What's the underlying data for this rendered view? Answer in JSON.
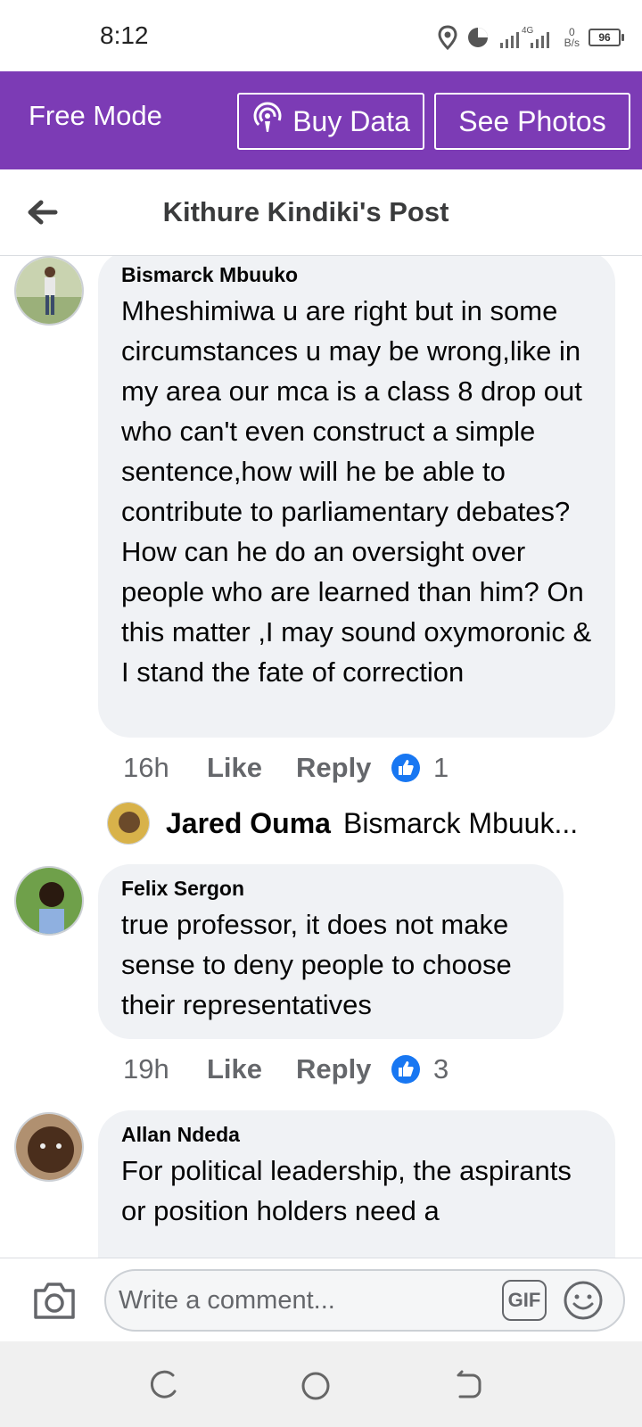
{
  "status_bar": {
    "time": "8:12",
    "network_type": "4G",
    "speed_value": "0",
    "speed_unit": "B/s",
    "battery": "96"
  },
  "free_mode": {
    "label": "Free Mode",
    "buy_data": "Buy Data",
    "see_photos": "See Photos"
  },
  "header": {
    "title": "Kithure Kindiki's Post"
  },
  "comments": [
    {
      "author": "Bismarck Mbuuko",
      "text": "Mheshimiwa u are right but in some circumstances u may be wrong,like in my area our mca is a class 8 drop out who can't even construct a simple sentence,how will he be able to contribute to parliamentary debates? How can he do an oversight over people who are learned than him? On this matter ,I may sound oxymoronic & I stand the fate of correction",
      "time": "16h",
      "like_label": "Like",
      "reply_label": "Reply",
      "like_count": "1",
      "reply_preview": {
        "name": "Jared Ouma",
        "snippet": "Bismarck Mbuuk..."
      }
    },
    {
      "author": "Felix Sergon",
      "text": "true professor, it does not make sense to deny people to choose their representatives",
      "time": "19h",
      "like_label": "Like",
      "reply_label": "Reply",
      "like_count": "3"
    },
    {
      "author": "Allan Ndeda",
      "text": "For political leadership, the aspirants or position holders need a"
    }
  ],
  "composer": {
    "placeholder": "Write a comment...",
    "gif_label": "GIF"
  },
  "colors": {
    "free_mode_bar": "#7c3bb5",
    "bubble": "#f0f2f5",
    "like_blue": "#1877f2",
    "meta_gray": "#65676b"
  },
  "icons": [
    "location-icon",
    "data-usage-icon",
    "signal-icon",
    "battery-icon",
    "broadcast-icon",
    "back-arrow-icon",
    "like-reaction-icon",
    "camera-icon",
    "gif-icon",
    "emoji-icon",
    "recent-apps-icon",
    "home-icon",
    "back-nav-icon"
  ]
}
